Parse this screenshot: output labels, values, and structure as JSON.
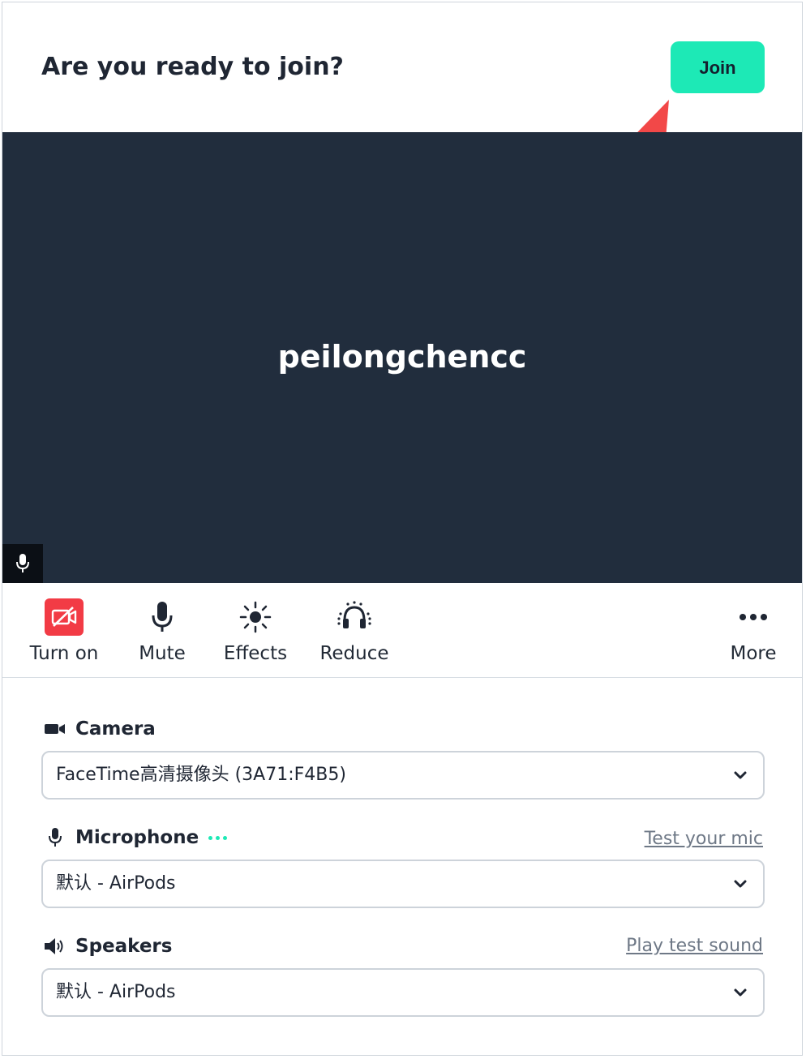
{
  "header": {
    "title": "Are you ready to join?",
    "join_label": "Join"
  },
  "preview": {
    "display_name": "peilongchencc"
  },
  "toolbar": {
    "items": [
      {
        "label": "Turn on",
        "icon": "camera-off-icon",
        "color": "#f23b45"
      },
      {
        "label": "Mute",
        "icon": "microphone-icon"
      },
      {
        "label": "Effects",
        "icon": "sun-effects-icon"
      },
      {
        "label": "Reduce",
        "icon": "headphones-noise-icon"
      },
      {
        "label": "More",
        "icon": "more-dots-icon"
      }
    ]
  },
  "settings": {
    "camera": {
      "label": "Camera",
      "icon": "video-camera-icon",
      "selected": "FaceTime高清摄像头 (3A71:F4B5)"
    },
    "microphone": {
      "label": "Microphone",
      "icon": "microphone-icon",
      "link": "Test your mic",
      "selected": "默认 - AirPods"
    },
    "speakers": {
      "label": "Speakers",
      "icon": "speaker-icon",
      "link": "Play test sound",
      "selected": "默认 - AirPods"
    }
  },
  "colors": {
    "accent": "#1de9b6",
    "preview_bg": "#212d3d",
    "camera_off": "#f23b45",
    "arrow": "#f24848"
  }
}
